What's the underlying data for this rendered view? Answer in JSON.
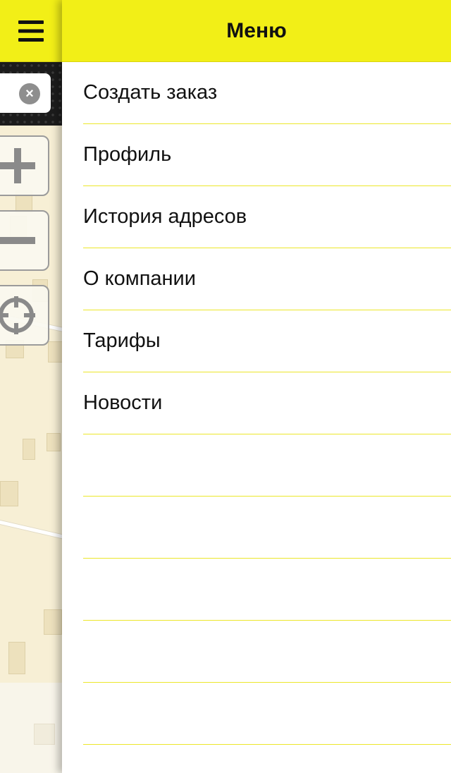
{
  "menu": {
    "title": "Меню",
    "items": [
      {
        "label": "Создать заказ"
      },
      {
        "label": "Профиль"
      },
      {
        "label": "История адресов"
      },
      {
        "label": "О компании"
      },
      {
        "label": "Тарифы"
      },
      {
        "label": "Новости"
      },
      {
        "label": ""
      },
      {
        "label": ""
      },
      {
        "label": ""
      },
      {
        "label": ""
      },
      {
        "label": ""
      }
    ]
  },
  "map": {
    "search_clear_icon": "close-icon",
    "controls": [
      "zoom-in-icon",
      "zoom-out-icon",
      "locate-icon"
    ]
  },
  "colors": {
    "accent": "#f2ef17",
    "divider": "#ece72a",
    "map_background": "#f7efd5",
    "toolbar": "#1c1c1c"
  }
}
